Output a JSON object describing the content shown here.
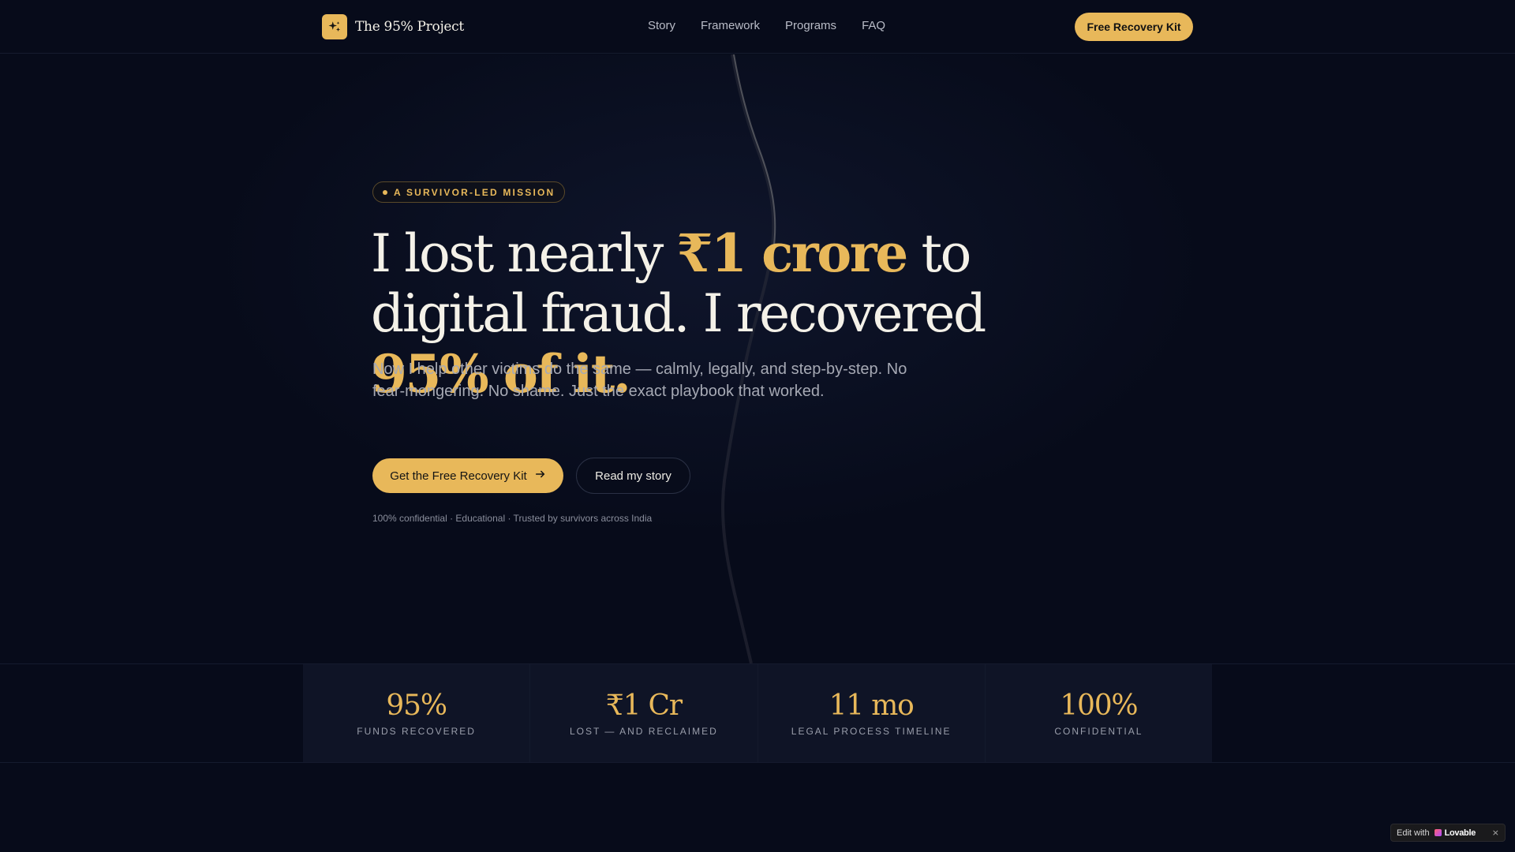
{
  "nav": {
    "brand": "The 95% Project",
    "brand_icon": "sparkles-icon",
    "links": [
      "Story",
      "Framework",
      "Programs",
      "FAQ"
    ],
    "cta": "Free Recovery Kit"
  },
  "hero": {
    "badge": "A SURVIVOR-LED MISSION",
    "headline": {
      "part1": "I lost nearly ",
      "highlight1": "₹1 crore",
      "part2": " to digital fraud. I recovered ",
      "highlight2": "95% of it."
    },
    "subhead": "Now I help other victims do the same — calmly, legally, and step-by-step. No fear-mongering. No shame. Just the exact playbook that worked.",
    "primary_cta": "Get the Free Recovery Kit",
    "primary_cta_icon": "arrow-right-icon",
    "secondary_cta": "Read my story",
    "trust": "100% confidential · Educational · Trusted by survivors across India"
  },
  "stats": [
    {
      "value": "95%",
      "label": "FUNDS RECOVERED"
    },
    {
      "value": "₹1 Cr",
      "label": "LOST — AND RECLAIMED"
    },
    {
      "value": "11 mo",
      "label": "LEGAL PROCESS TIMELINE"
    },
    {
      "value": "100%",
      "label": "CONFIDENTIAL"
    }
  ],
  "lovable_badge": {
    "edit": "Edit with",
    "brand": "Lovable",
    "close": "×"
  },
  "colors": {
    "background": "#070b1a",
    "accent": "#e8b85a",
    "text": "#f4f1e8",
    "muted": "#a6a9b4"
  }
}
